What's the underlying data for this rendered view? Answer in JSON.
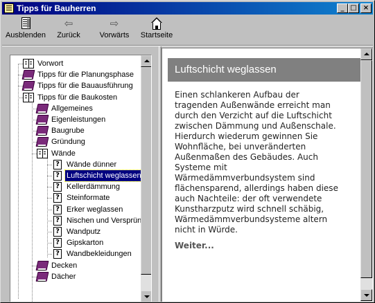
{
  "window": {
    "title": "Tipps für Bauherren",
    "controls": [
      "_",
      "□",
      "×"
    ]
  },
  "toolbar": {
    "hide_label": "Ausblenden",
    "back_label": "Zurück",
    "forward_label": "Vorwärts",
    "home_label": "Startseite"
  },
  "tree": {
    "items": [
      {
        "label": "Vorwort",
        "icon": "book-open-icon",
        "level": 0
      },
      {
        "label": "Tipps für die Planungsphase",
        "icon": "book-closed-icon",
        "level": 0
      },
      {
        "label": "Tipps für die Bauausführung",
        "icon": "book-closed-icon",
        "level": 0
      },
      {
        "label": "Tipps für die Baukosten",
        "icon": "book-open-icon",
        "level": 0
      },
      {
        "label": "Allgemeines",
        "icon": "book-closed-icon",
        "level": 1
      },
      {
        "label": "Eigenleistungen",
        "icon": "book-closed-icon",
        "level": 1
      },
      {
        "label": "Baugrube",
        "icon": "book-closed-icon",
        "level": 1
      },
      {
        "label": "Gründung",
        "icon": "book-closed-icon",
        "level": 1
      },
      {
        "label": "Wände",
        "icon": "book-open-icon",
        "level": 1
      },
      {
        "label": "Wände dünner",
        "icon": "help-page-icon",
        "level": 2
      },
      {
        "label": "Luftschicht weglassen",
        "icon": "help-page-icon",
        "level": 2,
        "selected": true
      },
      {
        "label": "Kellerdämmung",
        "icon": "help-page-icon",
        "level": 2
      },
      {
        "label": "Steinformate",
        "icon": "help-page-icon",
        "level": 2
      },
      {
        "label": "Erker weglassen",
        "icon": "help-page-icon",
        "level": 2
      },
      {
        "label": "Nischen und Versprünge",
        "icon": "help-page-icon",
        "level": 2
      },
      {
        "label": "Wandputz",
        "icon": "help-page-icon",
        "level": 2
      },
      {
        "label": "Gipskarton",
        "icon": "help-page-icon",
        "level": 2
      },
      {
        "label": "Wandbekleidungen",
        "icon": "help-page-icon",
        "level": 2
      },
      {
        "label": "Decken",
        "icon": "book-closed-icon",
        "level": 1
      },
      {
        "label": "Dächer",
        "icon": "book-closed-icon",
        "level": 1
      }
    ]
  },
  "topic": {
    "title": "Luftschicht weglassen",
    "body_lines": [
      "Einen schlankeren Aufbau der",
      "tragenden Außenwände erreicht man",
      "durch den Verzicht auf die Luftschicht",
      "zwischen Dämmung und Außenschale.",
      "Hierdurch wiederum gewinnen Sie",
      "Wohnfläche, bei unveränderten",
      "Außenmaßen des Gebäudes. Auch",
      "Systeme mit",
      "Wärmedämmverbundsystem sind",
      "flächensparend, allerdings haben diese",
      "auch Nachteile: der oft verwendete",
      "Kunstharzputz wird schnell schäbig,",
      "Wärmedämmverbundsysteme altern",
      "nicht in Würde."
    ],
    "more_link": "Weiter..."
  },
  "colors": {
    "titlebar_start": "#000080",
    "titlebar_end": "#1084d0",
    "selection": "#000080",
    "header_band": "#808080"
  }
}
